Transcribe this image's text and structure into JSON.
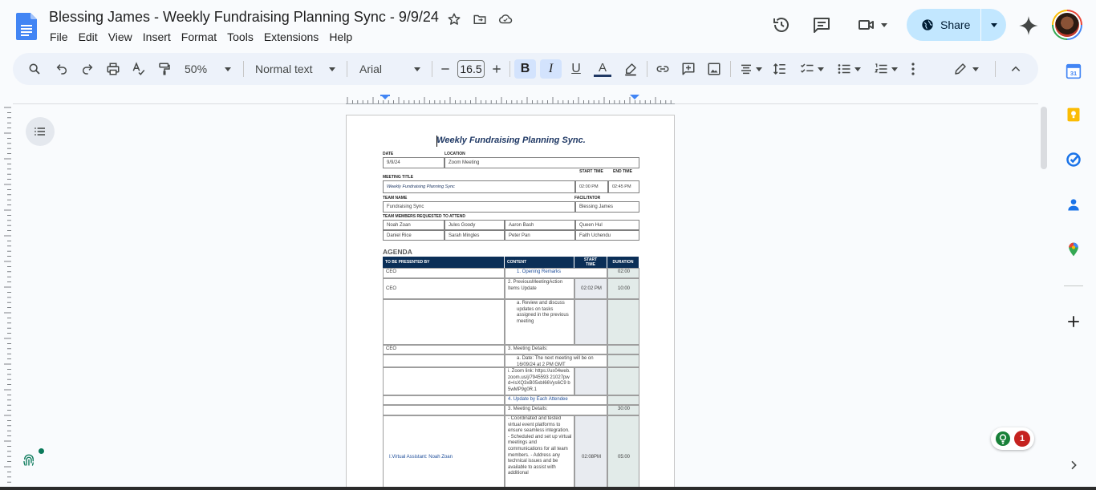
{
  "document": {
    "title": "Blessing James - Weekly Fundraising Planning Sync - 9/9/24"
  },
  "menu": [
    "File",
    "Edit",
    "View",
    "Insert",
    "Format",
    "Tools",
    "Extensions",
    "Help"
  ],
  "share": {
    "label": "Share"
  },
  "toolbar": {
    "zoom": "50%",
    "style": "Normal text",
    "font": "Arial",
    "font_size": "16.5"
  },
  "page": {
    "heading": "Weekly Fundraising Planning Sync.",
    "labels": {
      "date": "DATE",
      "location": "LOCATION",
      "meeting_title": "MEETING TITLE",
      "start_time": "START TIME",
      "end_time": "END TIME",
      "team_name": "TEAM NAME",
      "facilitator": "FACILITATOR",
      "team_members": "TEAM MEMBERS REQUESTED TO ATTEND"
    },
    "values": {
      "date": "9/9/24",
      "location": "Zoom Meeting",
      "meeting_title": "Weekly Fundraising Planning Sync",
      "start_time": "02:00 PM",
      "end_time": "02:45 PM",
      "team_name": "Fundraising Sync",
      "facilitator": "Blessing James"
    },
    "members": [
      [
        "Noah Zoan",
        "Jules Goody",
        "Aaron Bash",
        "Queen Hul"
      ],
      [
        "Daniel Rice",
        "Sarah Mingles",
        "Peter Pan",
        "Faith Uchendu"
      ]
    ],
    "agenda": {
      "title": "AGENDA",
      "headers": [
        "TO BE PRESENTED BY",
        "CONTENT",
        "START TIME",
        "DURATION"
      ],
      "rows": {
        "r1": {
          "by": "CEO",
          "content": "1.    Opening Remarks",
          "start": "",
          "dur": "02:00"
        },
        "r2": {
          "by": "CEO",
          "content": "2. PreviousMeetingAction Items Update",
          "start": "02:02 PM",
          "dur": "10:00"
        },
        "r3": {
          "content": "a.    Review and discuss updates on tasks assigned in the previous meeting"
        },
        "r4": {
          "by": "CEO",
          "content": "3. Meeting Details:"
        },
        "r5": {
          "content": "a.    Date: The next meeting will be on 16/09/24 at 2 PM GMT"
        },
        "r6": {
          "content": "i. Zoom link: https://us04web.zoom.us/j/7945593 21027pwd=IsXQ3xB05xbI66Vys6C9 b5wMP9g0R.1"
        },
        "r7": {
          "content": "4. Update by Each Attendee"
        },
        "r8": {
          "content": "3. Meeting Details:",
          "dur": "30:00"
        },
        "r9": {
          "by": "I.Virtual Assistant: Noah Zoan",
          "content": "- Coordinated and tested virtual event platforms to ensure seamless integration. - Scheduled and set up virtual meetings and communications for all team members. - Address any technical issues and be available to assist with additional",
          "start": "02:08PM",
          "dur": "05:00"
        }
      }
    }
  },
  "suggestions": {
    "count": "1"
  },
  "icons": {
    "history": "history-icon",
    "comments": "comment-icon",
    "meet": "video-camera-icon",
    "gemini": "sparkle-icon"
  },
  "colors": {
    "share_bg": "#c2e7ff",
    "toolbar_bg": "#edf2fa",
    "table_header": "#0b2f57",
    "heading": "#1f3864"
  }
}
